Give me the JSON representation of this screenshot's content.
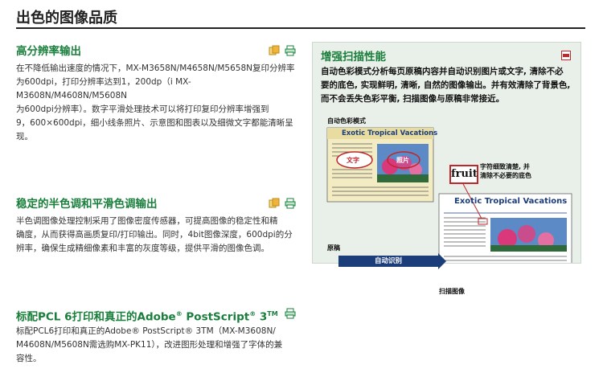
{
  "page": {
    "title": "出色的图像品质"
  },
  "sections": [
    {
      "title": "高分辨率输出",
      "body": "在不降低输出速度的情况下，MX-M3658N/M4658N/M5658N复印分辨率\n为600dpi，打印分辨率达到1，200dp（i MX-M3608N/M4608N/M5608N\n为600dpi分辨率）。数字平滑处理技术可以将打印复印分辨率增强到\n9，600×600dpi，细小线条照片、示意图和图表以及细微文字都能清晰呈现。"
    },
    {
      "title": "稳定的半色调和平滑色调输出",
      "body": "半色调图像处理控制采用了图像密度传感器，可提高图像的稳定性和精\n确度，从而获得高画质复印/打印输出。同时，4bit图像深度，600dpi的分\n辨率，确保生成精细像素和丰富的灰度等级，提供平滑的图像色调。"
    },
    {
      "title_main": "标配PCL 6打印和真正的Adobe",
      "title_reg": "®",
      "title_ps": " PostScript",
      "title_reg2": "®",
      "title_3": " 3",
      "title_tm": "TM",
      "body": "标配PCL6打印和真正的Adobe® PostScript® 3TM（MX-M3608N/\nM4608N/M5608N需选购MX-PK11），改进图形处理和增强了字体的兼\n容性。"
    }
  ],
  "panel": {
    "title": "增强扫描性能",
    "text": "自动色彩模式分析每页原稿内容并自动识别图片或文字, 清除不必要的底色, 实现鲜明, 清晰, 自然的图像输出。并有效清除了背景色, 而不会丢失色彩平衡, 扫描图像与原稿非常接近。",
    "auto_color_label": "自动色彩模式",
    "original_label": "原稿",
    "scan_label": "扫描图像",
    "arrow_label": "自动识别",
    "fruit_word": "fruit",
    "fruit_note": "字符细致清楚, 并\n清除不必要的底色",
    "doc_title": "Exotic Tropical Vacations",
    "text_tag": "文字",
    "photo_tag": "照片"
  },
  "colors": {
    "accent_green": "#1a7f3c",
    "title_rule": "#222222",
    "panel_bg": "#e9efe9",
    "doc_blue": "#1b3d7a",
    "mark_red": "#c0262a"
  },
  "icons": [
    "copy-icon",
    "print-icon",
    "pdf-icon"
  ]
}
